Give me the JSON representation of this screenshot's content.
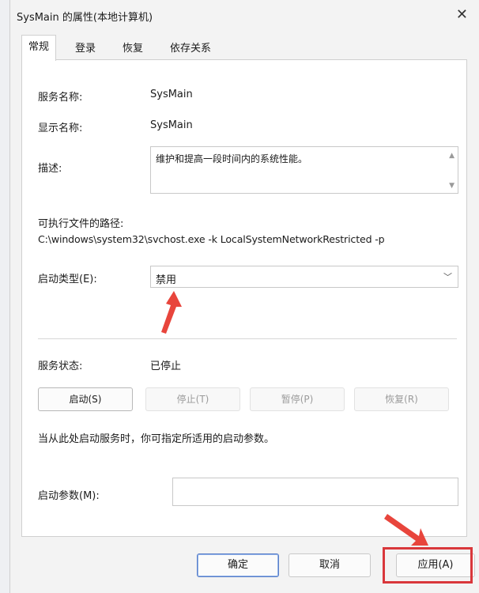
{
  "window": {
    "title": "SysMain 的属性(本地计算机)",
    "close": "✕"
  },
  "tabs": [
    {
      "label": "常规",
      "active": true
    },
    {
      "label": "登录"
    },
    {
      "label": "恢复"
    },
    {
      "label": "依存关系"
    }
  ],
  "general": {
    "service_name_label": "服务名称:",
    "service_name_value": "SysMain",
    "display_name_label": "显示名称:",
    "display_name_value": "SysMain",
    "description_label": "描述:",
    "description_value": "维护和提高一段时间内的系统性能。",
    "path_label": "可执行文件的路径:",
    "path_value": "C:\\windows\\system32\\svchost.exe -k LocalSystemNetworkRestricted -p",
    "startup_type_label": "启动类型(E):",
    "startup_type_value": "禁用",
    "service_status_label": "服务状态:",
    "service_status_value": "已停止",
    "start_label": "启动(S)",
    "stop_label": "停止(T)",
    "pause_label": "暂停(P)",
    "resume_label": "恢复(R)",
    "hint_text": "当从此处启动服务时，你可指定所适用的启动参数。",
    "start_params_label": "启动参数(M):",
    "start_params_value": ""
  },
  "footer": {
    "ok_label": "确定",
    "cancel_label": "取消",
    "apply_label": "应用(A)"
  },
  "colors": {
    "annotation_red": "#d9373b",
    "accent": "#5a7fc8"
  }
}
